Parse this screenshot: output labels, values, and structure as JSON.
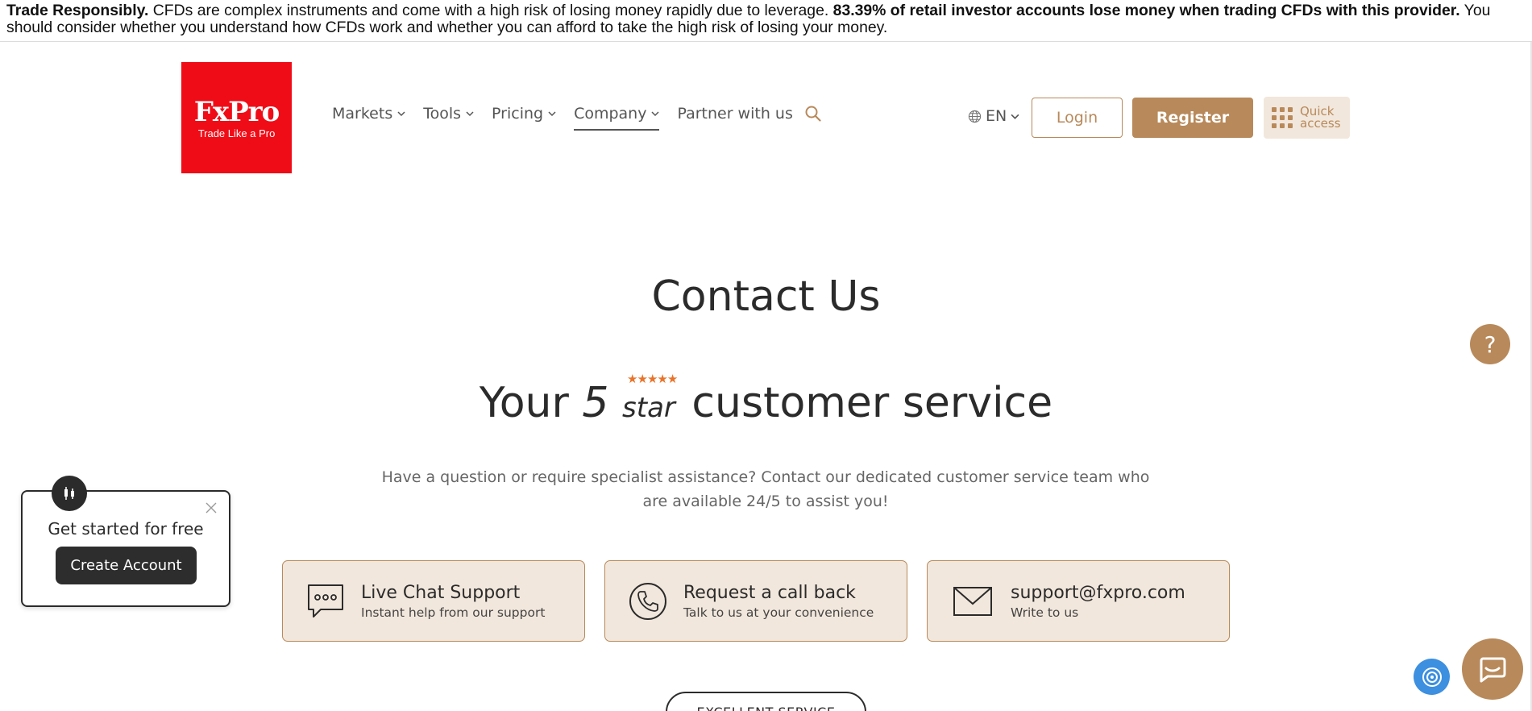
{
  "risk_banner": {
    "lead": "Trade Responsibly.",
    "text1": " CFDs are complex instruments and come with a high risk of losing money rapidly due to leverage. ",
    "stat": "83.39% of retail investor accounts lose money when trading CFDs with this provider.",
    "text2": " You should consider whether you understand how CFDs work and whether you can afford to take the high risk of losing your money."
  },
  "logo": {
    "brand": "FxPro",
    "tagline": "Trade Like a Pro",
    "color": "#f00c17"
  },
  "nav": {
    "items": [
      {
        "label": "Markets",
        "active": false
      },
      {
        "label": "Tools",
        "active": false
      },
      {
        "label": "Pricing",
        "active": false
      },
      {
        "label": "Company",
        "active": true
      }
    ],
    "partner_label": "Partner with us",
    "search_icon": "search-icon"
  },
  "header": {
    "language": "EN",
    "login_label": "Login",
    "register_label": "Register",
    "quick_access_line1": "Quick",
    "quick_access_line2": "access"
  },
  "hero": {
    "title": "Contact Us",
    "subtitle_pre": "Your ",
    "subtitle_five": "5",
    "subtitle_stars": "★★★★★",
    "subtitle_star_word": "star",
    "subtitle_post": " customer service",
    "intro": "Have a question or require specialist assistance? Contact our dedicated customer service team who are available 24/5 to assist you!"
  },
  "contact_cards": [
    {
      "title": "Live Chat Support",
      "subtitle": "Instant help from our support",
      "icon": "chat-bubble-icon"
    },
    {
      "title": "Request a call back",
      "subtitle": "Talk to us at your convenience",
      "icon": "phone-icon"
    },
    {
      "title": "support@fxpro.com",
      "subtitle": "Write to us",
      "icon": "envelope-icon"
    }
  ],
  "excellent_service_label": "EXCELLENT SERVICE",
  "popup": {
    "title": "Get started for free",
    "button_label": "Create Account"
  },
  "help_label": "?",
  "colors": {
    "accent": "#b8895a",
    "accent_light": "#f2e7dc",
    "text": "#2b2b2b",
    "star": "#e8742a"
  }
}
